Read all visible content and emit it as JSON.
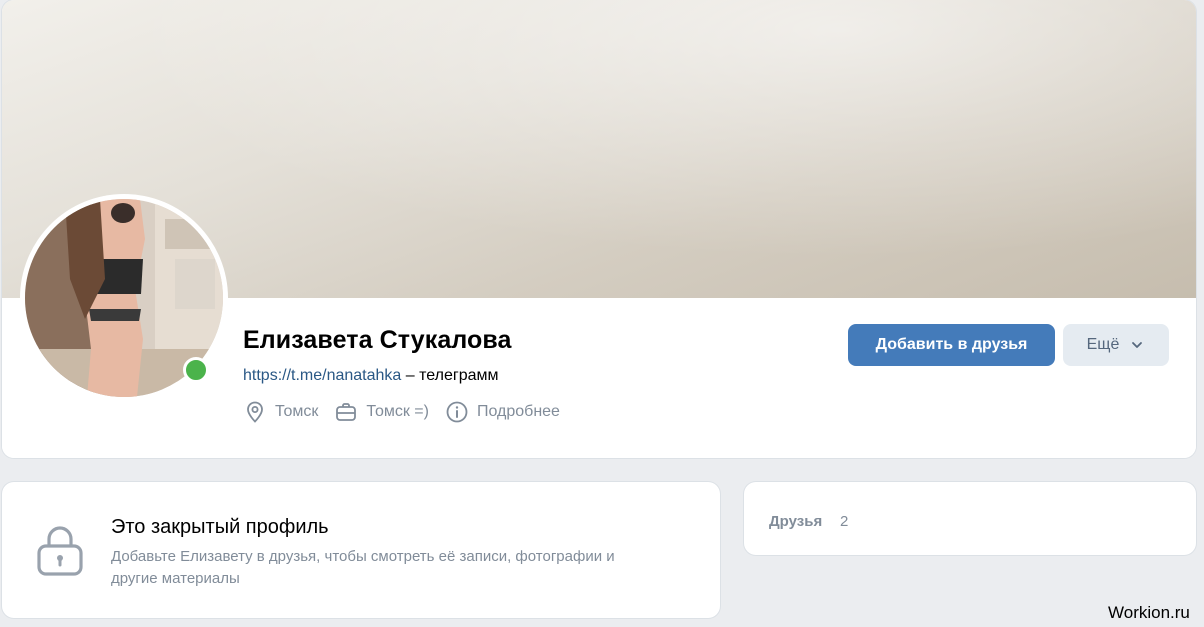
{
  "profile": {
    "name": "Елизавета Стукалова",
    "status_link": "https://t.me/nanatahka",
    "status_suffix": " – телеграмм",
    "online": true,
    "meta": {
      "city": "Томск",
      "work": "Томск =)",
      "details": "Подробнее"
    },
    "actions": {
      "add_friend": "Добавить в друзья",
      "more": "Ещё"
    }
  },
  "private_profile": {
    "title": "Это закрытый профиль",
    "description": "Добавьте Елизавету в друзья, чтобы смотреть её записи, фотографии и другие материалы"
  },
  "friends": {
    "label": "Друзья",
    "count": "2"
  },
  "watermark": "Workion.ru",
  "colors": {
    "accent_button": "#447bba",
    "secondary_button": "#e5ebf1",
    "link": "#2a5885",
    "online": "#4bb34b",
    "muted_text": "#818c99"
  }
}
